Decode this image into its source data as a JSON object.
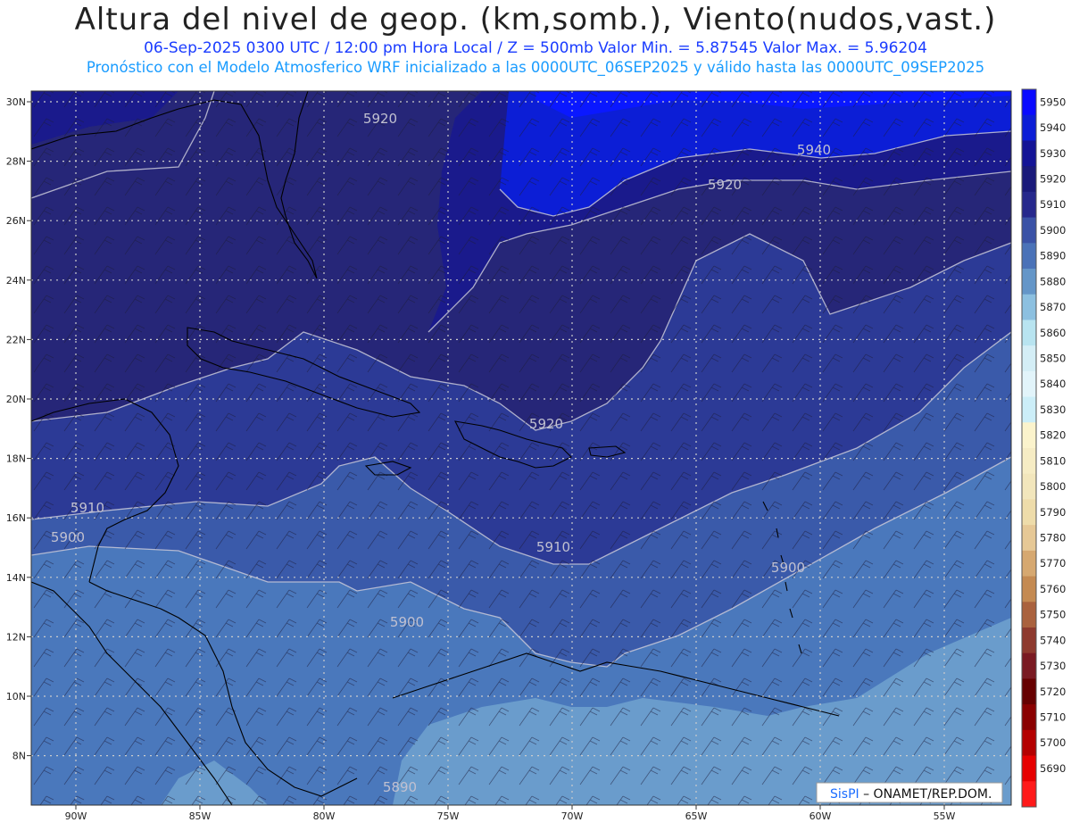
{
  "header": {
    "title": "Altura del nivel de geop. (km,somb.), Viento(nudos,vast.)",
    "subtitle_line1": "06-Sep-2025  0300 UTC / 12:00 pm Hora Local / Z = 500mb     Valor Min. = 5.87545   Valor Max. = 5.96204",
    "subtitle_line2": "Pronóstico con el Modelo Atmosferico WRF inicializado a las 0000UTC_06SEP2025 y válido hasta las  0000UTC_09SEP2025"
  },
  "map": {
    "lat_labels": [
      "30N",
      "28N",
      "26N",
      "24N",
      "22N",
      "20N",
      "18N",
      "16N",
      "14N",
      "12N",
      "10N",
      "8N"
    ],
    "lon_labels": [
      "90W",
      "85W",
      "80W",
      "75W",
      "70W",
      "65W",
      "60W",
      "55W"
    ],
    "contour_labels": [
      "5920",
      "5920",
      "5940",
      "5920",
      "5910",
      "5900",
      "5910",
      "5900",
      "5900",
      "5890"
    ],
    "colors": {
      "c5950": "#0a18ff",
      "c5940": "#0c1ed6",
      "c5930": "#1a1a8c",
      "c5920": "#262678",
      "c5910": "#2c3a96",
      "c5900": "#3a5aaa",
      "c5890": "#4a78bc",
      "c5880": "#6a9ccc",
      "grid": "#cccccc",
      "coast": "#000000"
    }
  },
  "colorbar": {
    "labels": [
      "5950",
      "5940",
      "5930",
      "5920",
      "5910",
      "5900",
      "5890",
      "5880",
      "5870",
      "5860",
      "5850",
      "5840",
      "5830",
      "5820",
      "5810",
      "5800",
      "5790",
      "5780",
      "5770",
      "5760",
      "5750",
      "5740",
      "5730",
      "5720",
      "5710",
      "5700",
      "5690"
    ],
    "colors": [
      "#0a0aff",
      "#0c1ed6",
      "#141496",
      "#1a1a7a",
      "#26288c",
      "#3a52a6",
      "#4a72b8",
      "#6496c8",
      "#8cc0e0",
      "#b8e4f0",
      "#d4eef6",
      "#e2f4fa",
      "#cceef8",
      "#fbf3cc",
      "#f6ecc4",
      "#f2e6bc",
      "#eedcaa",
      "#e6c896",
      "#d6a870",
      "#c48a52",
      "#aa623e",
      "#8e3a2e",
      "#7a1a22",
      "#660000",
      "#8a0000",
      "#b40000",
      "#e60000",
      "#ff1a1a"
    ]
  },
  "footer": {
    "brand": "SisPI",
    "brand_suffix": " – ONAMET/REP.DOM."
  }
}
